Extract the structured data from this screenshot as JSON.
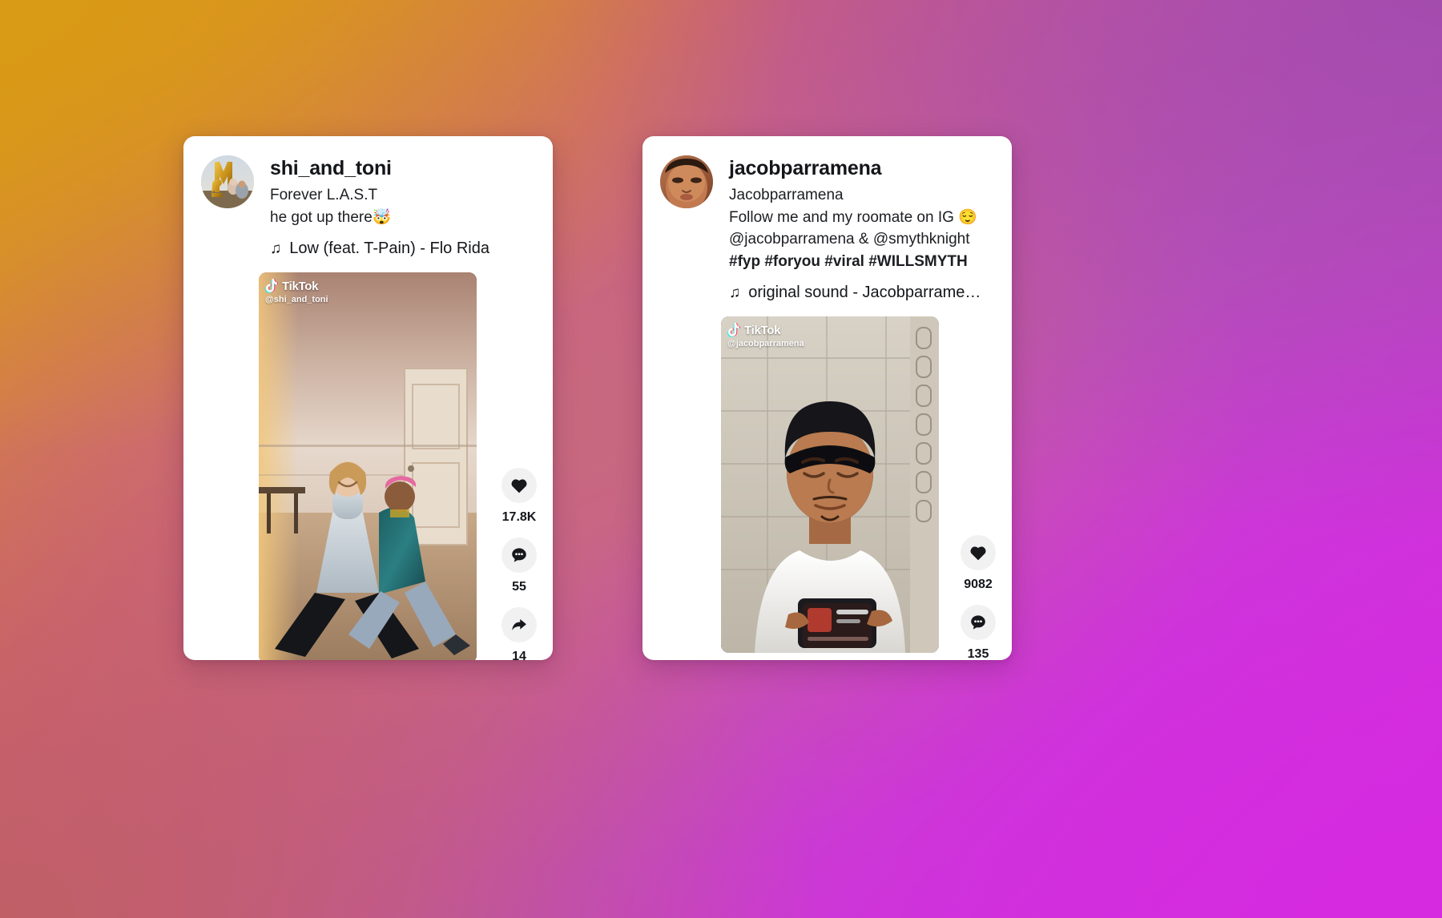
{
  "background": {
    "corner_top_left": "#d99a15",
    "corner_top_right": "#a44bae",
    "corner_bottom_left": "#c05f66",
    "corner_bottom_right": "#d52ae0"
  },
  "cards": [
    {
      "username": "shi_and_toni",
      "display_name": "Forever L.A.S.T",
      "caption": "he got up there🤯",
      "music_icon": "♫",
      "music": "Low (feat. T-Pain) - Flo Rida",
      "watermark_brand": "TikTok",
      "watermark_handle": "@shi_and_toni",
      "metrics": [
        {
          "icon": "heart-icon",
          "count": "17.8K"
        },
        {
          "icon": "comment-icon",
          "count": "55"
        },
        {
          "icon": "share-icon",
          "count": "14"
        }
      ]
    },
    {
      "username": "jacobparramena",
      "display_name": "Jacobparramena",
      "caption_line1": "Follow me and my roomate on IG",
      "caption_emoji": "😌",
      "caption_mention1": "@jacobparramena &",
      "caption_mention2": "@smythknight",
      "caption_tags": "#fyp #foryou #viral",
      "caption_tag_last": "#WILLSMYTH",
      "music_icon": "♫",
      "music": "original sound - Jacobparrame…",
      "watermark_brand": "TikTok",
      "watermark_handle": "@jacobparramena",
      "metrics": [
        {
          "icon": "heart-icon",
          "count": "9082"
        },
        {
          "icon": "comment-icon",
          "count": "135"
        }
      ]
    }
  ]
}
